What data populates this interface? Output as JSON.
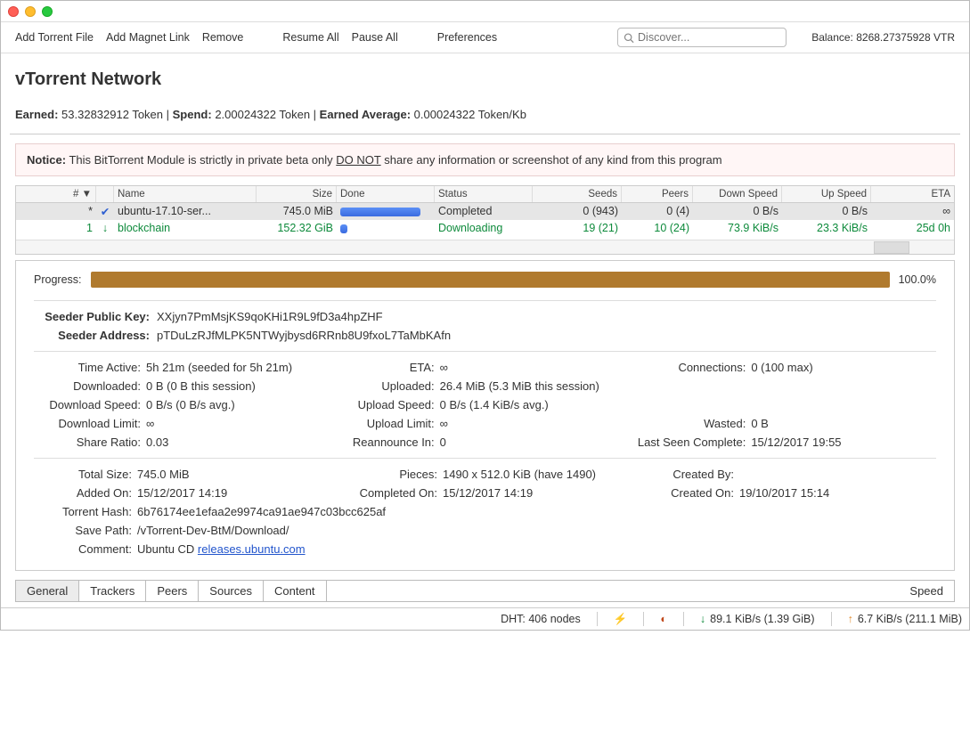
{
  "title": "vTorrent Network",
  "toolbar": {
    "add_file": "Add Torrent File",
    "add_magnet": "Add Magnet Link",
    "remove": "Remove",
    "resume_all": "Resume All",
    "pause_all": "Pause All",
    "preferences": "Preferences",
    "search_placeholder": "Discover...",
    "balance_label": "Balance:",
    "balance_value": "8268.27375928 VTR"
  },
  "stats": {
    "earned_label": "Earned:",
    "earned_value": "53.32832912 Token",
    "spend_label": "Spend:",
    "spend_value": "2.00024322 Token",
    "avg_label": "Earned Average:",
    "avg_value": "0.00024322 Token/Kb"
  },
  "notice": {
    "prefix": "Notice:",
    "text1": "This BitTorrent Module is strictly in private beta only ",
    "emph": "DO NOT",
    "text2": " share any information or screenshot of any kind from this program"
  },
  "columns": [
    "# ▼",
    "",
    "Name",
    "Size",
    "Done",
    "Status",
    "Seeds",
    "Peers",
    "Down Speed",
    "Up Speed",
    "ETA"
  ],
  "torrents": [
    {
      "num": "*",
      "name": "ubuntu-17.10-ser...",
      "size": "745.0 MiB",
      "status": "Completed",
      "seeds": "0 (943)",
      "peers": "0 (4)",
      "dspeed": "0 B/s",
      "uspeed": "0 B/s",
      "eta": "∞"
    },
    {
      "num": "1",
      "name": "blockchain",
      "size": "152.32 GiB",
      "status": "Downloading",
      "seeds": "19 (21)",
      "peers": "10 (24)",
      "dspeed": "73.9 KiB/s",
      "uspeed": "23.3 KiB/s",
      "eta": "25d 0h"
    }
  ],
  "detail": {
    "progress_label": "Progress:",
    "progress_pct": "100.0%",
    "seeder_pk_label": "Seeder Public Key:",
    "seeder_pk": "XXjyn7PmMsjKS9qoKHi1R9L9fD3a4hpZHF",
    "seeder_addr_label": "Seeder Address:",
    "seeder_addr": "pTDuLzRJfMLPK5NTWyjbysd6RRnb8U9fxoL7TaMbKAfn",
    "time_active_label": "Time Active:",
    "time_active": "5h 21m (seeded for 5h 21m)",
    "eta_label": "ETA:",
    "eta": "∞",
    "connections_label": "Connections:",
    "connections": "0 (100 max)",
    "downloaded_label": "Downloaded:",
    "downloaded": "0 B (0 B this session)",
    "uploaded_label": "Uploaded:",
    "uploaded": "26.4 MiB (5.3 MiB this session)",
    "dspeed_label": "Download Speed:",
    "dspeed": "0 B/s (0 B/s avg.)",
    "uspeed_label": "Upload Speed:",
    "uspeed": "0 B/s (1.4 KiB/s avg.)",
    "dlimit_label": "Download Limit:",
    "dlimit": "∞",
    "ulimit_label": "Upload Limit:",
    "ulimit": "∞",
    "wasted_label": "Wasted:",
    "wasted": "0 B",
    "ratio_label": "Share Ratio:",
    "ratio": "0.03",
    "reannounce_label": "Reannounce In:",
    "reannounce": "0",
    "lastseen_label": "Last Seen Complete:",
    "lastseen": "15/12/2017  19:55",
    "totalsize_label": "Total Size:",
    "totalsize": "745.0 MiB",
    "pieces_label": "Pieces:",
    "pieces": "1490 x 512.0 KiB (have 1490)",
    "createdby_label": "Created By:",
    "createdby": "",
    "addedon_label": "Added On:",
    "addedon": "15/12/2017  14:19",
    "completedon_label": "Completed On:",
    "completedon": "15/12/2017  14:19",
    "createdon_label": "Created On:",
    "createdon": "19/10/2017  15:14",
    "hash_label": "Torrent Hash:",
    "hash": "6b76174ee1efaa2e9974ca91ae947c03bcc625af",
    "savepath_label": "Save Path:",
    "savepath": "/vTorrent-Dev-BtM/Download/",
    "comment_label": "Comment:",
    "comment_text": "Ubuntu CD ",
    "comment_link": "releases.ubuntu.com"
  },
  "tabs": {
    "general": "General",
    "trackers": "Trackers",
    "peers": "Peers",
    "sources": "Sources",
    "content": "Content",
    "speed": "Speed"
  },
  "statusbar": {
    "dht": "DHT: 406 nodes",
    "down": "89.1 KiB/s (1.39 GiB)",
    "up": "6.7 KiB/s (211.1 MiB)"
  }
}
